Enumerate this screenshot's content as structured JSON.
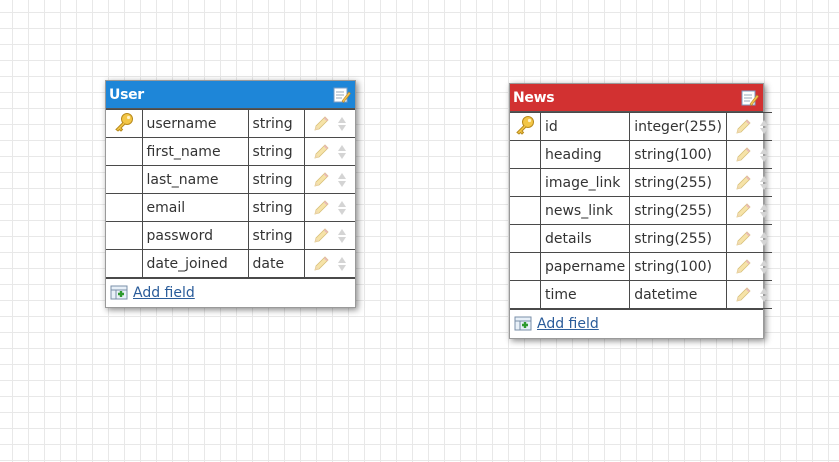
{
  "colors": {
    "user_header": "#1e86d8",
    "news_header": "#d23131",
    "link": "#2a5c9a"
  },
  "tables": [
    {
      "title": "User",
      "add_field_label": "Add field",
      "fields": [
        {
          "name": "username",
          "type": "string",
          "primary_key": true
        },
        {
          "name": "first_name",
          "type": "string",
          "primary_key": false
        },
        {
          "name": "last_name",
          "type": "string",
          "primary_key": false
        },
        {
          "name": "email",
          "type": "string",
          "primary_key": false
        },
        {
          "name": "password",
          "type": "string",
          "primary_key": false
        },
        {
          "name": "date_joined",
          "type": "date",
          "primary_key": false
        }
      ]
    },
    {
      "title": "News",
      "add_field_label": "Add field",
      "fields": [
        {
          "name": "id",
          "type": "integer(255)",
          "primary_key": true
        },
        {
          "name": "heading",
          "type": "string(100)",
          "primary_key": false
        },
        {
          "name": "image_link",
          "type": "string(255)",
          "primary_key": false
        },
        {
          "name": "news_link",
          "type": "string(255)",
          "primary_key": false
        },
        {
          "name": "details",
          "type": "string(255)",
          "primary_key": false
        },
        {
          "name": "papername",
          "type": "string(100)",
          "primary_key": false
        },
        {
          "name": "time",
          "type": "datetime",
          "primary_key": false
        }
      ]
    }
  ]
}
